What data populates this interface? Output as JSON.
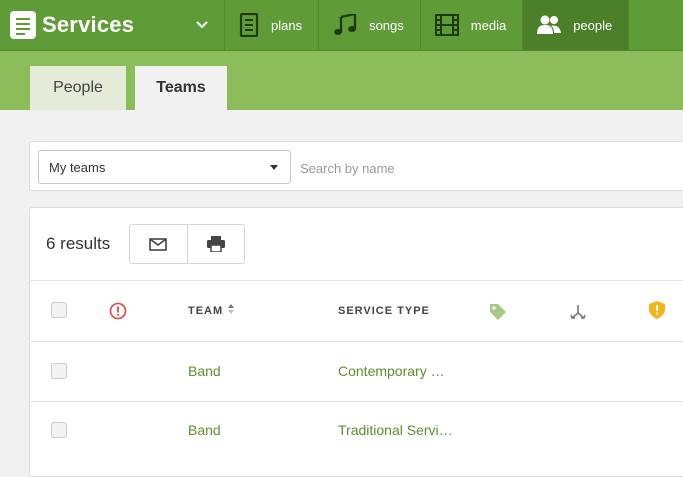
{
  "app": {
    "title": "Services"
  },
  "nav": {
    "items": [
      {
        "label": "plans",
        "icon": "document-icon"
      },
      {
        "label": "songs",
        "icon": "music-note-icon"
      },
      {
        "label": "media",
        "icon": "film-strip-icon"
      },
      {
        "label": "people",
        "icon": "people-icon",
        "active": true
      }
    ]
  },
  "tabs": [
    {
      "label": "People",
      "active": false
    },
    {
      "label": "Teams",
      "active": true
    }
  ],
  "filter": {
    "selected": "My teams",
    "search_placeholder": "Search by name"
  },
  "results": {
    "count_text": "6 results",
    "actions": [
      "mail-icon",
      "print-icon"
    ]
  },
  "table": {
    "columns": {
      "team": "TEAM",
      "service_type": "SERVICE TYPE",
      "icons": [
        "alert-circle-icon",
        "tag-icon",
        "merge-icon",
        "shield-icon"
      ]
    },
    "rows": [
      {
        "team": "Band",
        "service_type": "Contemporary …"
      },
      {
        "team": "Band",
        "service_type": "Traditional Servi…"
      }
    ]
  },
  "colors": {
    "topbar": "#5f9b36",
    "subbar": "#8dbd5a",
    "link": "#5d8f2f",
    "alert": "#e0443a",
    "shield": "#f3b51c"
  }
}
